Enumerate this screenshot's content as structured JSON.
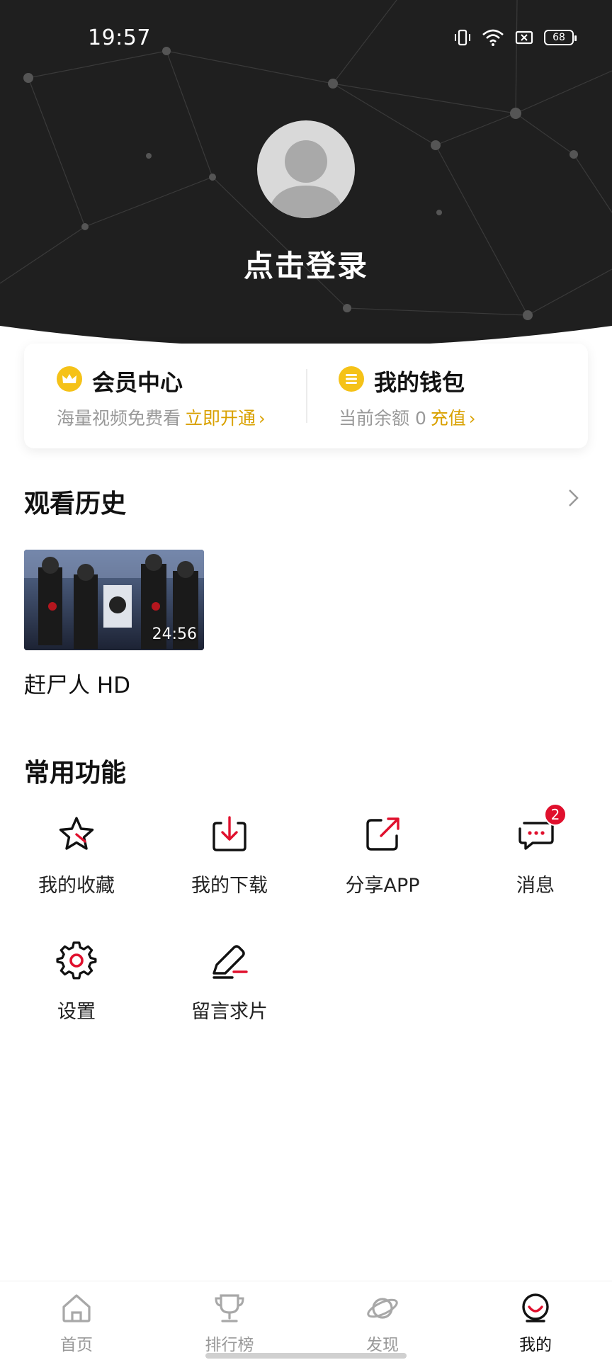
{
  "status_bar": {
    "time": "19:57",
    "battery": "68"
  },
  "profile": {
    "login_label": "点击登录"
  },
  "vip_card": {
    "member": {
      "title": "会员中心",
      "subtitle": "海量视频免费看",
      "action": "立即开通"
    },
    "wallet": {
      "title": "我的钱包",
      "subtitle": "当前余额 0",
      "action": "充值"
    }
  },
  "history": {
    "title": "观看历史",
    "items": [
      {
        "title": "赶尸人  HD",
        "duration": "24:56"
      }
    ]
  },
  "functions": {
    "title": "常用功能",
    "items": [
      {
        "label": "我的收藏",
        "icon": "star-icon"
      },
      {
        "label": "我的下载",
        "icon": "download-icon"
      },
      {
        "label": "分享APP",
        "icon": "share-icon"
      },
      {
        "label": "消息",
        "icon": "message-icon",
        "badge": "2"
      },
      {
        "label": "设置",
        "icon": "gear-icon"
      },
      {
        "label": "留言求片",
        "icon": "edit-icon"
      }
    ]
  },
  "bottom_nav": {
    "items": [
      {
        "label": "首页",
        "icon": "home-icon",
        "active": false
      },
      {
        "label": "排行榜",
        "icon": "trophy-icon",
        "active": false
      },
      {
        "label": "发现",
        "icon": "planet-icon",
        "active": false
      },
      {
        "label": "我的",
        "icon": "profile-icon",
        "active": true
      }
    ]
  },
  "colors": {
    "accent_red": "#e0102d",
    "gold": "#d9a100",
    "header_bg": "#1f1f1f"
  }
}
